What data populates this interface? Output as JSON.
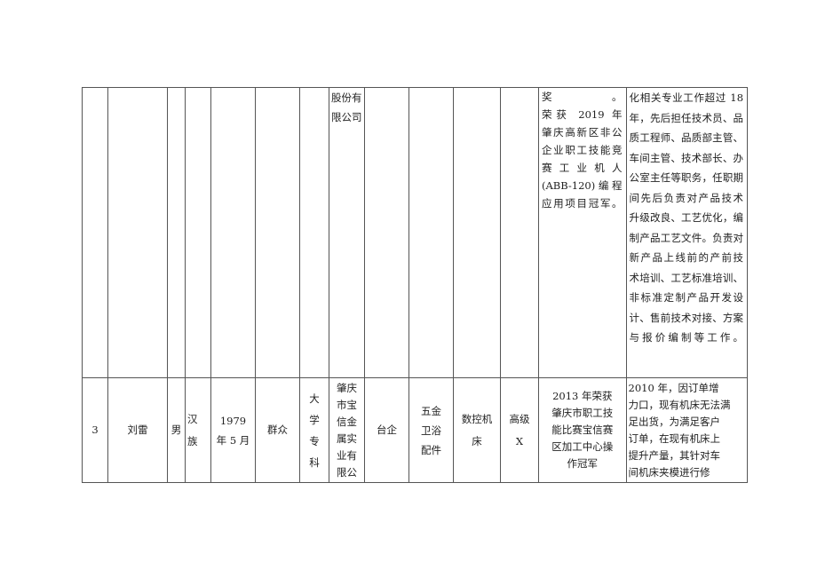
{
  "table": {
    "row1": {
      "company_cont": [
        "股份有",
        "限公司"
      ],
      "award_cont": [
        "奖。",
        "荣获 2019 年",
        "肇庆高新区非公",
        "企业职工技能竞",
        "赛 工 业 机 人",
        "(ABB-120) 编 程",
        "应用项目冠军。"
      ],
      "desc_cont": [
        "化相关专业工作超过 18",
        "年，先后担任技术员、品",
        "质工程师、品质部主管、",
        "车间主管、技术部长、办",
        "公室主任等职务，任职期",
        "间先后负责对产品技术",
        "升级改良、工艺优化，编",
        "制产品工艺文件。负责对",
        "新产品上线前的产前技",
        "术培训、工艺标准培训、",
        "非标准定制产品开发设",
        "计、售前技术对接、方案",
        "与报价编制等工作。"
      ]
    },
    "row2": {
      "index": "3",
      "name": "刘雷",
      "gender": "男",
      "ethnicity": [
        "汉",
        "族"
      ],
      "birth": [
        "1979",
        "年 5 月"
      ],
      "political_status": "群众",
      "education": [
        "大",
        "学",
        "专",
        "科"
      ],
      "company": [
        "肇庆",
        "市宝",
        "信金",
        "属实",
        "业有",
        "限公"
      ],
      "company_type": "台企",
      "industry": [
        "五金",
        "卫浴",
        "配件"
      ],
      "occupation": [
        "数控机",
        "床"
      ],
      "level": [
        "高级",
        "X"
      ],
      "award": [
        "2013 年荣获",
        "肇庆市职工技",
        "能比赛宝信赛",
        "区加工中心操",
        "作冠军"
      ],
      "description": [
        "2010 年，因订单增",
        "力口，现有机床无法满",
        "足出货，为满足客户",
        "订单，在现有机床上",
        "提升产量，其针对车",
        "间机床夹模进行修"
      ]
    }
  }
}
